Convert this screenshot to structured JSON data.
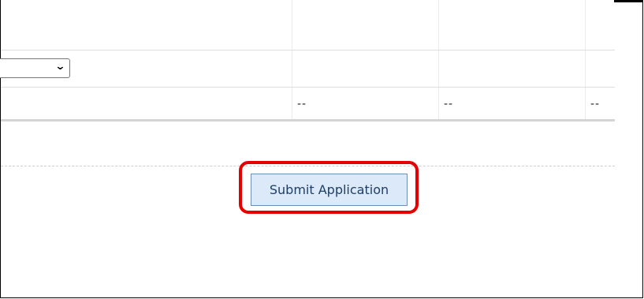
{
  "table": {
    "empty_values": [
      "--",
      "--",
      "--"
    ]
  },
  "form": {
    "select_chevron": "chevron-down-icon",
    "submit_label": "Submit Application"
  },
  "annotation": {
    "highlight_color": "#e60000"
  }
}
